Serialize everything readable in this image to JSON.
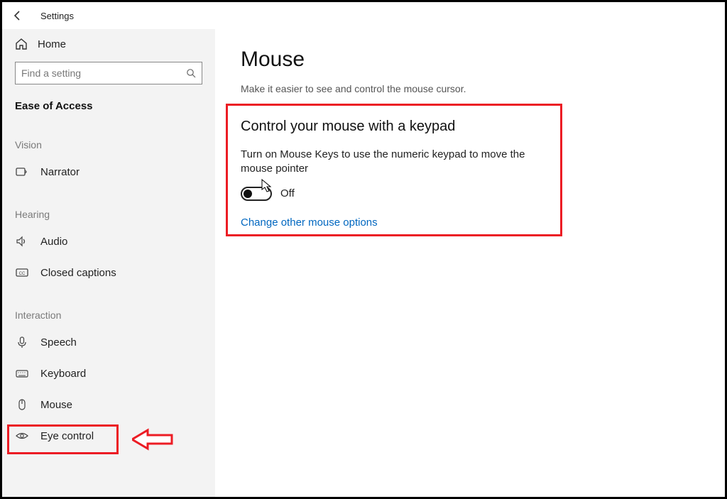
{
  "titlebar": {
    "title": "Settings"
  },
  "sidebar": {
    "home_label": "Home",
    "search_placeholder": "Find a setting",
    "section_title": "Ease of Access",
    "groups": {
      "vision": "Vision",
      "hearing": "Hearing",
      "interaction": "Interaction"
    },
    "items": {
      "narrator": "Narrator",
      "audio": "Audio",
      "closed_captions": "Closed captions",
      "speech": "Speech",
      "keyboard": "Keyboard",
      "mouse": "Mouse",
      "eye_control": "Eye control"
    }
  },
  "main": {
    "title": "Mouse",
    "subtitle": "Make it easier to see and control the mouse cursor.",
    "section_heading": "Control your mouse with a keypad",
    "section_desc": "Turn on Mouse Keys to use the numeric keypad to move the mouse pointer",
    "toggle_state": "Off",
    "link_text": "Change other mouse options"
  }
}
